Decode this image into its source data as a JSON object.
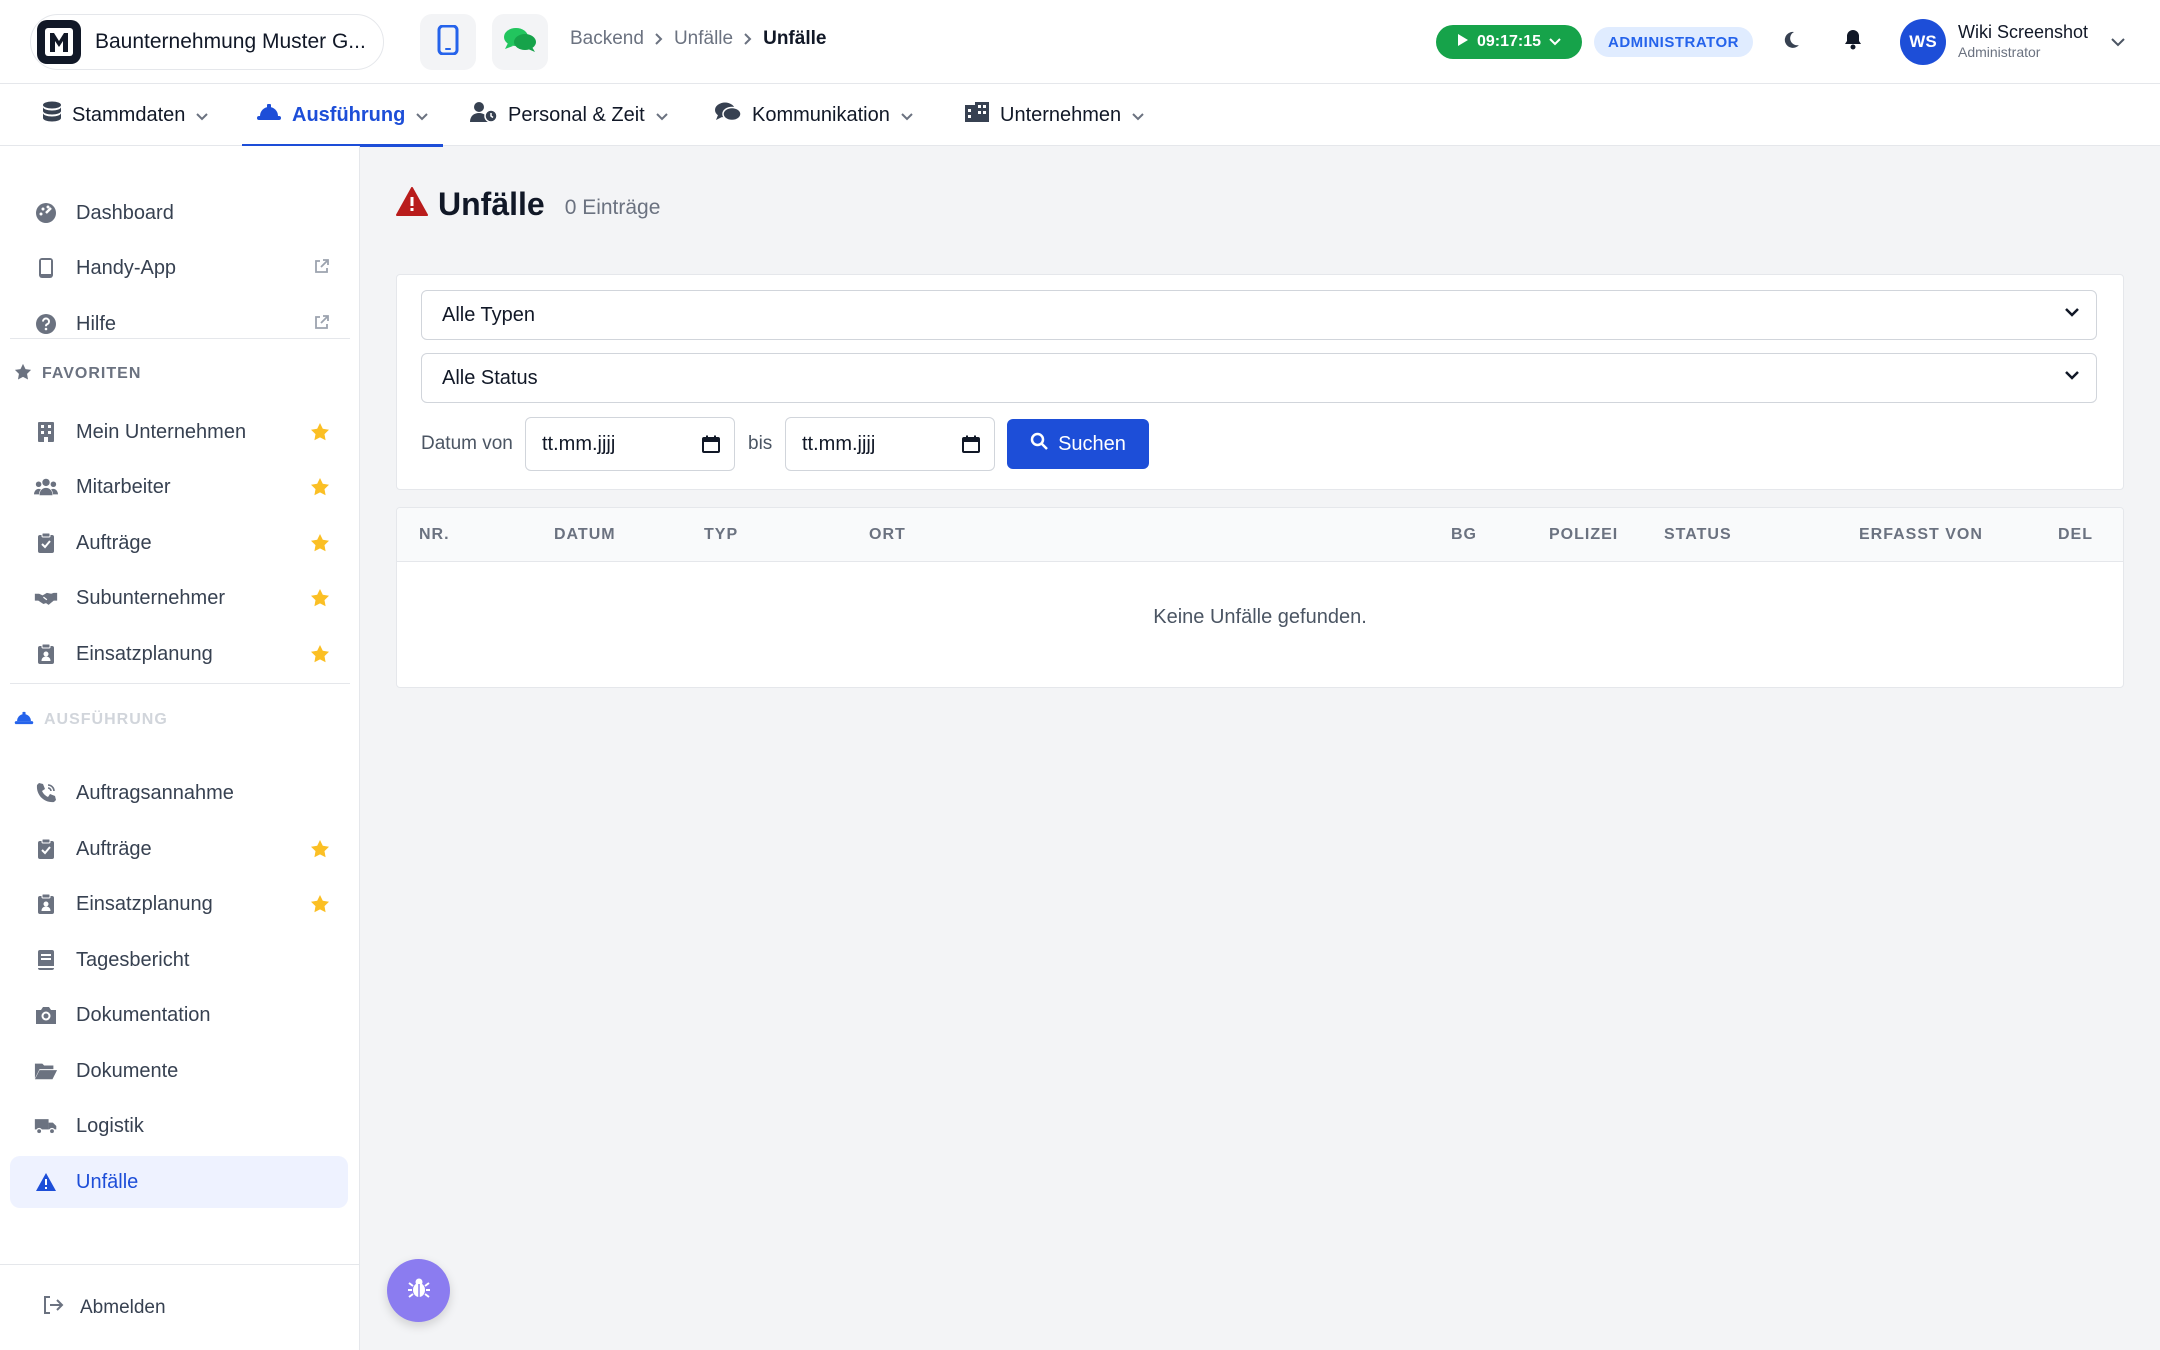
{
  "header": {
    "company": "Baunternehmung Muster G...",
    "logo_letter": "M",
    "breadcrumb": [
      "Backend",
      "Unfälle",
      "Unfälle"
    ],
    "timer": "09:17:15",
    "role_badge": "ADMINISTRATOR",
    "user": {
      "initials": "WS",
      "name": "Wiki Screenshot",
      "role": "Administrator"
    }
  },
  "mainnav": {
    "items": [
      {
        "label": "Stammdaten",
        "icon": "database-icon"
      },
      {
        "label": "Ausführung",
        "icon": "hardhat-icon",
        "active": true
      },
      {
        "label": "Personal & Zeit",
        "icon": "user-clock-icon"
      },
      {
        "label": "Kommunikation",
        "icon": "comments-icon"
      },
      {
        "label": "Unternehmen",
        "icon": "building-icon"
      }
    ]
  },
  "sidebar": {
    "top": [
      {
        "label": "Dashboard",
        "icon": "gauge-icon"
      },
      {
        "label": "Handy-App",
        "icon": "mobile-icon",
        "external": true
      },
      {
        "label": "Hilfe",
        "icon": "question-icon",
        "external": true
      }
    ],
    "favorites_title": "FAVORITEN",
    "favorites": [
      {
        "label": "Mein Unternehmen",
        "icon": "building-icon"
      },
      {
        "label": "Mitarbeiter",
        "icon": "users-icon"
      },
      {
        "label": "Aufträge",
        "icon": "clipboard-check-icon"
      },
      {
        "label": "Subunternehmer",
        "icon": "handshake-icon"
      },
      {
        "label": "Einsatzplanung",
        "icon": "clipboard-user-icon"
      }
    ],
    "section_title": "AUSFÜHRUNG",
    "section": [
      {
        "label": "Auftragsannahme",
        "icon": "phone-icon"
      },
      {
        "label": "Aufträge",
        "icon": "clipboard-check-icon",
        "star": true
      },
      {
        "label": "Einsatzplanung",
        "icon": "clipboard-user-icon",
        "star": true
      },
      {
        "label": "Tagesbericht",
        "icon": "book-icon"
      },
      {
        "label": "Dokumentation",
        "icon": "camera-icon"
      },
      {
        "label": "Dokumente",
        "icon": "folder-open-icon"
      },
      {
        "label": "Logistik",
        "icon": "truck-icon"
      },
      {
        "label": "Unfälle",
        "icon": "warning-icon",
        "active": true
      }
    ],
    "logout": "Abmelden"
  },
  "page": {
    "title": "Unfälle",
    "count": "0 Einträge"
  },
  "filters": {
    "type_select": "Alle Typen",
    "status_select": "Alle Status",
    "date_from_label": "Datum von",
    "date_from_placeholder": "tt.mm.jjjj",
    "date_to_label": "bis",
    "date_to_placeholder": "tt.mm.jjjj",
    "search_button": "Suchen"
  },
  "table": {
    "columns": [
      "NR.",
      "DATUM",
      "TYP",
      "ORT",
      "BG",
      "POLIZEI",
      "STATUS",
      "ERFASST VON",
      "DEL"
    ],
    "empty_message": "Keine Unfälle gefunden."
  },
  "colors": {
    "accent": "#1d4ed8",
    "timer_green": "#16a34a",
    "star": "#fbbf24",
    "warning_red": "#b91c1c",
    "fab": "#8b7cf0"
  }
}
